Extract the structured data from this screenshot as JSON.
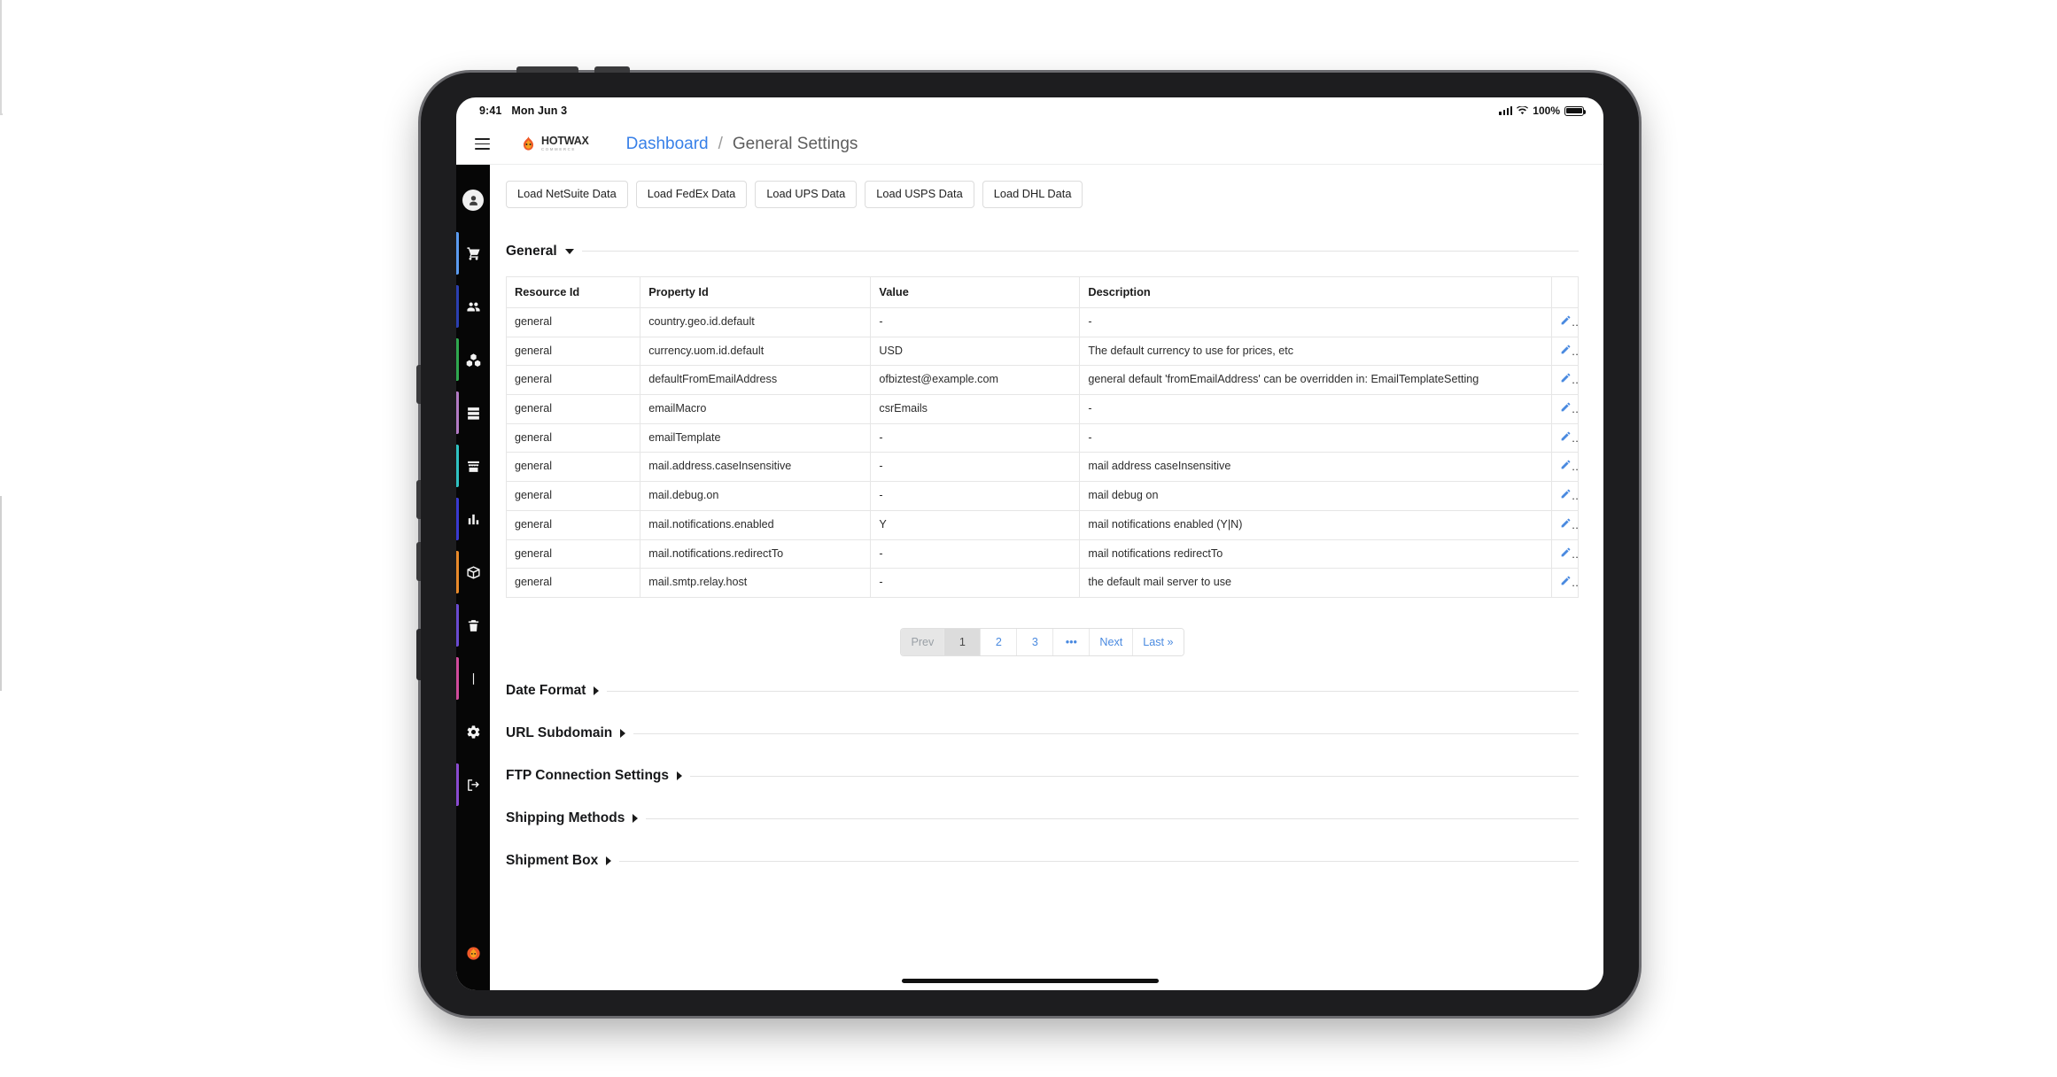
{
  "status_bar": {
    "time": "9:41",
    "date": "Mon Jun 3",
    "battery_percent": "100%"
  },
  "appbar": {
    "menu_icon": "hamburger-menu-icon",
    "brand_name": "HOTWAX",
    "brand_subtitle": "COMMERCE",
    "breadcrumb": {
      "parent": "Dashboard",
      "separator": "/",
      "current": "General Settings"
    }
  },
  "sidebar": {
    "items": [
      {
        "name": "user-avatar",
        "icon": "user-icon",
        "accent": ""
      },
      {
        "name": "orders",
        "icon": "cart-icon",
        "accent": "#5b9bf0"
      },
      {
        "name": "users",
        "icon": "people-icon",
        "accent": "#2b3fb0"
      },
      {
        "name": "inventory",
        "icon": "cubes-icon",
        "accent": "#2fa84f"
      },
      {
        "name": "catalog",
        "icon": "server-icon",
        "accent": "#b27ac4"
      },
      {
        "name": "facilities",
        "icon": "store-icon",
        "accent": "#2fc2c2"
      },
      {
        "name": "reports",
        "icon": "chart-icon",
        "accent": "#3a3ad0"
      },
      {
        "name": "shipping",
        "icon": "box-icon",
        "accent": "#e88a2a"
      },
      {
        "name": "trash",
        "icon": "trash-icon",
        "accent": "#6a4bd0"
      },
      {
        "name": "divider",
        "icon": "bar-icon",
        "accent": "#d04b9b"
      },
      {
        "name": "settings",
        "icon": "gear-icon",
        "accent": ""
      },
      {
        "name": "logout",
        "icon": "logout-icon",
        "accent": "#8a4bd0"
      }
    ],
    "footer": {
      "name": "bug-report",
      "icon": "bug-icon"
    }
  },
  "toolbar": {
    "load_buttons": [
      "Load NetSuite Data",
      "Load FedEx Data",
      "Load UPS Data",
      "Load USPS Data",
      "Load DHL Data"
    ]
  },
  "general_section": {
    "title": "General",
    "expanded": true,
    "table": {
      "columns": [
        "Resource Id",
        "Property Id",
        "Value",
        "Description"
      ],
      "rows": [
        {
          "resource": "general",
          "property": "country.geo.id.default",
          "value": "-",
          "description": "-"
        },
        {
          "resource": "general",
          "property": "currency.uom.id.default",
          "value": "USD",
          "description": "The default currency to use for prices, etc"
        },
        {
          "resource": "general",
          "property": "defaultFromEmailAddress",
          "value": "ofbiztest@example.com",
          "description": "general default 'fromEmailAddress' can be overridden in: EmailTemplateSetting"
        },
        {
          "resource": "general",
          "property": "emailMacro",
          "value": "csrEmails",
          "description": "-"
        },
        {
          "resource": "general",
          "property": "emailTemplate",
          "value": "-",
          "description": "-"
        },
        {
          "resource": "general",
          "property": "mail.address.caseInsensitive",
          "value": "-",
          "description": "mail address caseInsensitive"
        },
        {
          "resource": "general",
          "property": "mail.debug.on",
          "value": "-",
          "description": "mail debug on"
        },
        {
          "resource": "general",
          "property": "mail.notifications.enabled",
          "value": "Y",
          "description": "mail notifications enabled (Y|N)"
        },
        {
          "resource": "general",
          "property": "mail.notifications.redirectTo",
          "value": "-",
          "description": "mail notifications redirectTo"
        },
        {
          "resource": "general",
          "property": "mail.smtp.relay.host",
          "value": "-",
          "description": "the default mail server to use"
        }
      ],
      "row_action_icon": "pencil-icon"
    },
    "pagination": {
      "prev_label": "Prev",
      "pages": [
        "1",
        "2",
        "3"
      ],
      "ellipsis": "•••",
      "next_label": "Next",
      "last_label": "Last »",
      "current_page": "1"
    }
  },
  "collapsed_sections": [
    {
      "title": "Date Format"
    },
    {
      "title": "URL Subdomain"
    },
    {
      "title": "FTP Connection Settings"
    },
    {
      "title": "Shipping Methods"
    },
    {
      "title": "Shipment Box"
    }
  ],
  "colors": {
    "link": "#3880e8",
    "accent_blue": "#4a8ae0",
    "brand_orange": "#ef5a28"
  }
}
